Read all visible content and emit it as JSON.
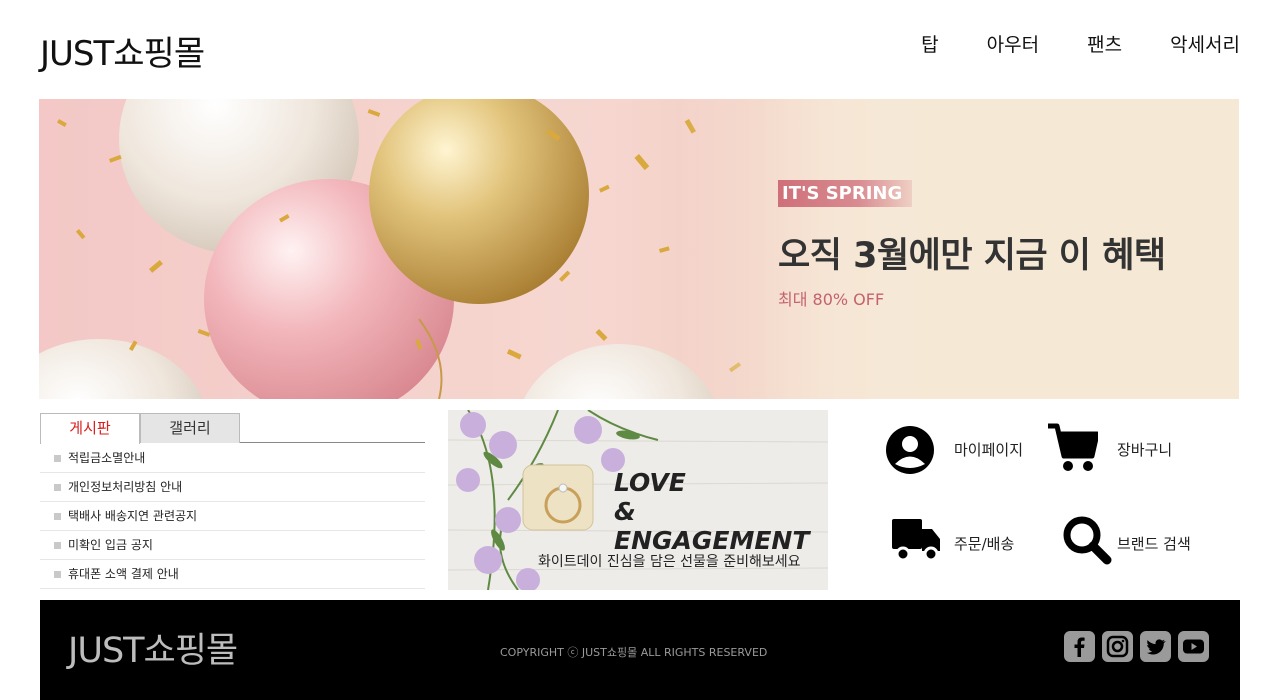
{
  "header": {
    "logo": "JUST쇼핑몰",
    "nav": [
      "탑",
      "아우터",
      "팬츠",
      "악세서리"
    ]
  },
  "hero": {
    "tag": "IT'S SPRING",
    "headline": "오직 3월에만 지금 이 혜택",
    "sub": "최대 80% OFF"
  },
  "board": {
    "tabs": [
      "게시판",
      "갤러리"
    ],
    "posts": [
      "적립금소멸안내",
      "개인정보처리방침 안내",
      "택배사 배송지연 관련공지",
      "미확인 입금 공지",
      "휴대폰 소액 결제 안내"
    ]
  },
  "promo": {
    "title_line1": "LOVE",
    "title_line2": "& ENGAGEMENT",
    "caption": "화이트데이  진심을 담은 선물을 준비해보세요"
  },
  "quick": {
    "items": [
      {
        "label": "마이페이지",
        "icon": "user-circle-icon"
      },
      {
        "label": "장바구니",
        "icon": "cart-icon"
      },
      {
        "label": "주문/배송",
        "icon": "truck-icon"
      },
      {
        "label": "브랜드 검색",
        "icon": "search-icon"
      }
    ]
  },
  "footer": {
    "logo": "JUST쇼핑몰",
    "copyright": "COPYRIGHT ⓒ JUST쇼핑몰 ALL RIGHTS RESERVED",
    "social": [
      "facebook-icon",
      "instagram-icon",
      "twitter-icon",
      "youtube-icon"
    ]
  },
  "colors": {
    "accent_red": "#d81e1e",
    "hero_tag_bg": "#cf6f79",
    "hero_sub": "#c4636c",
    "footer_bg": "#000000"
  }
}
